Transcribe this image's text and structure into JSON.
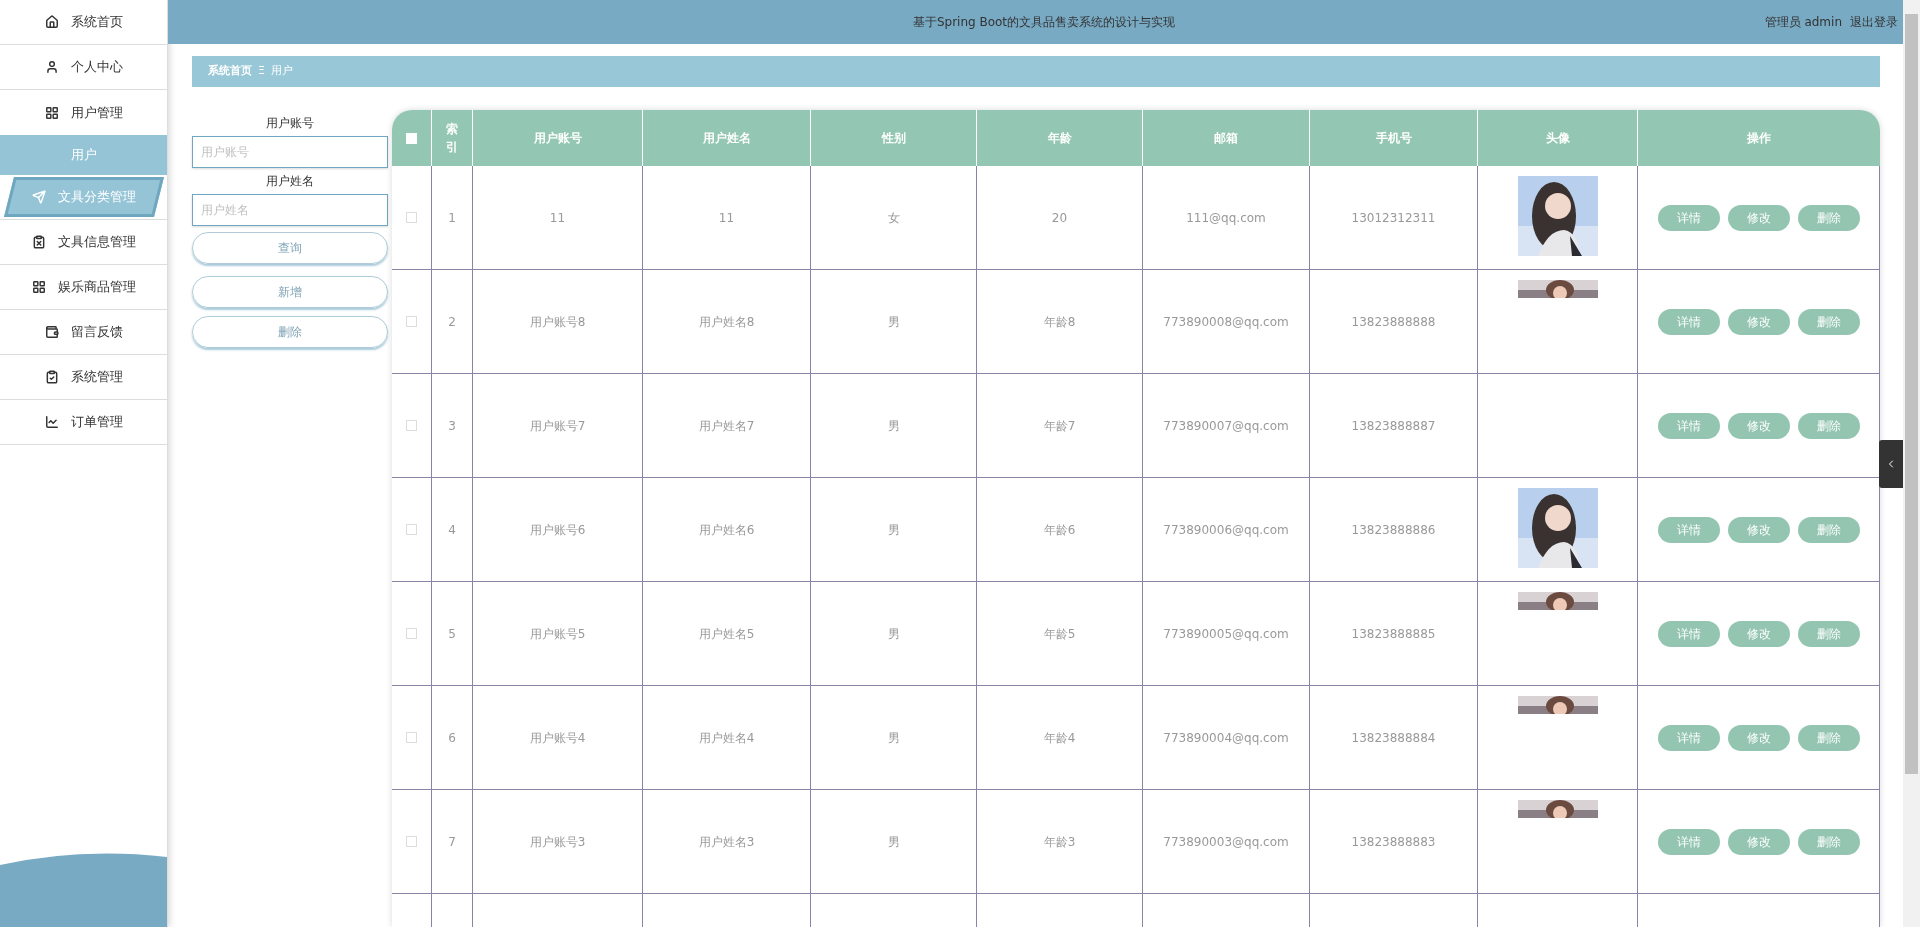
{
  "sidebar": {
    "items": [
      {
        "label": "系统首页",
        "kind": "home",
        "hovered": false
      },
      {
        "label": "个人中心",
        "kind": "user",
        "hovered": false
      },
      {
        "label": "用户管理",
        "kind": "grid",
        "hovered": false,
        "expanded": true,
        "children": [
          {
            "label": "用户",
            "selected": true
          }
        ]
      },
      {
        "label": "文具分类管理",
        "kind": "send",
        "hovered": true
      },
      {
        "label": "文具信息管理",
        "kind": "clipboard-x",
        "hovered": false
      },
      {
        "label": "娱乐商品管理",
        "kind": "grid",
        "hovered": false
      },
      {
        "label": "留言反馈",
        "kind": "wallet",
        "hovered": false
      },
      {
        "label": "系统管理",
        "kind": "clipboard-check",
        "hovered": false
      },
      {
        "label": "订单管理",
        "kind": "chart",
        "hovered": false
      }
    ]
  },
  "header": {
    "title": "基于Spring Boot的文具品售卖系统的设计与实现",
    "user": "管理员 admin",
    "logout": "退出登录"
  },
  "breadcrumb": {
    "home": "系统首页",
    "separator": "Ξ",
    "current": "用户"
  },
  "search": {
    "fields": [
      {
        "label": "用户账号",
        "placeholder": "用户账号"
      },
      {
        "label": "用户姓名",
        "placeholder": "用户姓名"
      }
    ],
    "query_button": "查询",
    "add_button": "新增",
    "delete_button": "删除"
  },
  "table": {
    "select_all_checked": false,
    "columns": [
      "索引",
      "用户账号",
      "用户姓名",
      "性别",
      "年龄",
      "邮箱",
      "手机号",
      "头像",
      "操作"
    ],
    "rows": [
      {
        "checked": false,
        "cells": [
          "1",
          "11",
          "11",
          "女",
          "20",
          "111@qq.com",
          "13012312311"
        ],
        "actions": [
          "详情",
          "修改",
          "删除"
        ]
      },
      {
        "checked": false,
        "cells": [
          "2",
          "用户账号8",
          "用户姓名8",
          "男",
          "年龄8",
          "773890008@qq.com",
          "13823888888"
        ],
        "avatar": {
          "kind": "partial"
        },
        "actions": [
          "详情",
          "修改",
          "删除"
        ]
      },
      {
        "checked": false,
        "cells": [
          "3",
          "用户账号7",
          "用户姓名7",
          "男",
          "年龄7",
          "773890007@qq.com",
          "13823888887"
        ],
        "avatar": {
          "kind": "none"
        },
        "actions": [
          "详情",
          "修改",
          "删除"
        ]
      },
      {
        "checked": false,
        "cells": [
          "4",
          "用户账号6",
          "用户姓名6",
          "男",
          "年龄6",
          "773890006@qq.com",
          "13823888886"
        ],
        "actions": [
          "详情",
          "修改",
          "删除"
        ]
      },
      {
        "checked": false,
        "cells": [
          "5",
          "用户账号5",
          "用户姓名5",
          "男",
          "年龄5",
          "773890005@qq.com",
          "13823888885"
        ],
        "avatar": {
          "kind": "partial"
        },
        "actions": [
          "详情",
          "修改",
          "删除"
        ]
      },
      {
        "checked": false,
        "cells": [
          "6",
          "用户账号4",
          "用户姓名4",
          "男",
          "年龄4",
          "773890004@qq.com",
          "13823888884"
        ],
        "avatar": {
          "kind": "partial"
        },
        "actions": [
          "详情",
          "修改",
          "删除"
        ]
      },
      {
        "checked": false,
        "cells": [
          "7",
          "用户账号3",
          "用户姓名3",
          "男",
          "年龄3",
          "773890003@qq.com",
          "13823888883"
        ],
        "avatar": {
          "kind": "partial"
        },
        "actions": [
          "详情",
          "修改",
          "删除"
        ]
      }
    ]
  }
}
